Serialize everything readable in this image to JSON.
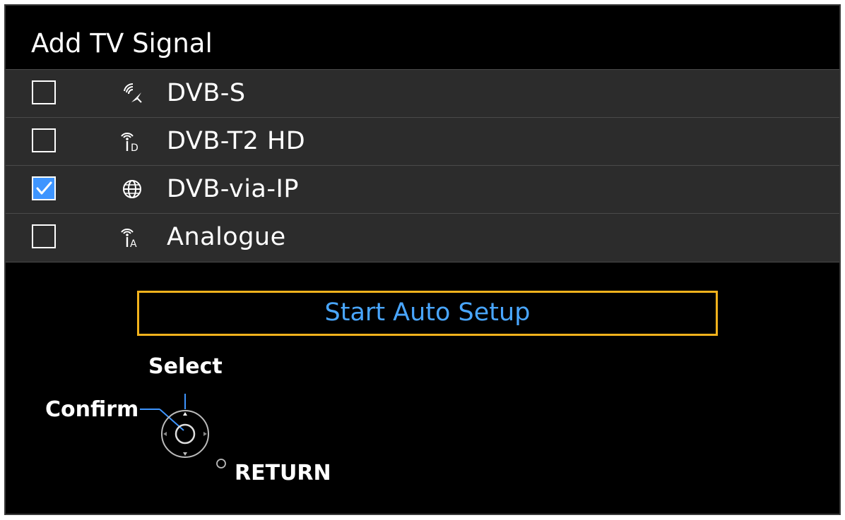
{
  "dialog": {
    "title": "Add TV Signal"
  },
  "signals": [
    {
      "label": "DVB-S",
      "checked": false,
      "icon": "satellite-dish-icon"
    },
    {
      "label": "DVB-T2 HD",
      "checked": false,
      "icon": "antenna-digital-icon"
    },
    {
      "label": "DVB-via-IP",
      "checked": true,
      "icon": "globe-icon"
    },
    {
      "label": "Analogue",
      "checked": false,
      "icon": "antenna-analogue-icon"
    }
  ],
  "start_button": {
    "label": "Start Auto Setup"
  },
  "hints": {
    "select": "Select",
    "confirm": "Confirm",
    "return": "RETURN"
  },
  "colors": {
    "background": "#000000",
    "row": "#2c2c2c",
    "accent_blue": "#49a6ff",
    "checkbox_checked": "#3e95ff",
    "focus_border": "#f2b21c",
    "text": "#ffffff"
  }
}
